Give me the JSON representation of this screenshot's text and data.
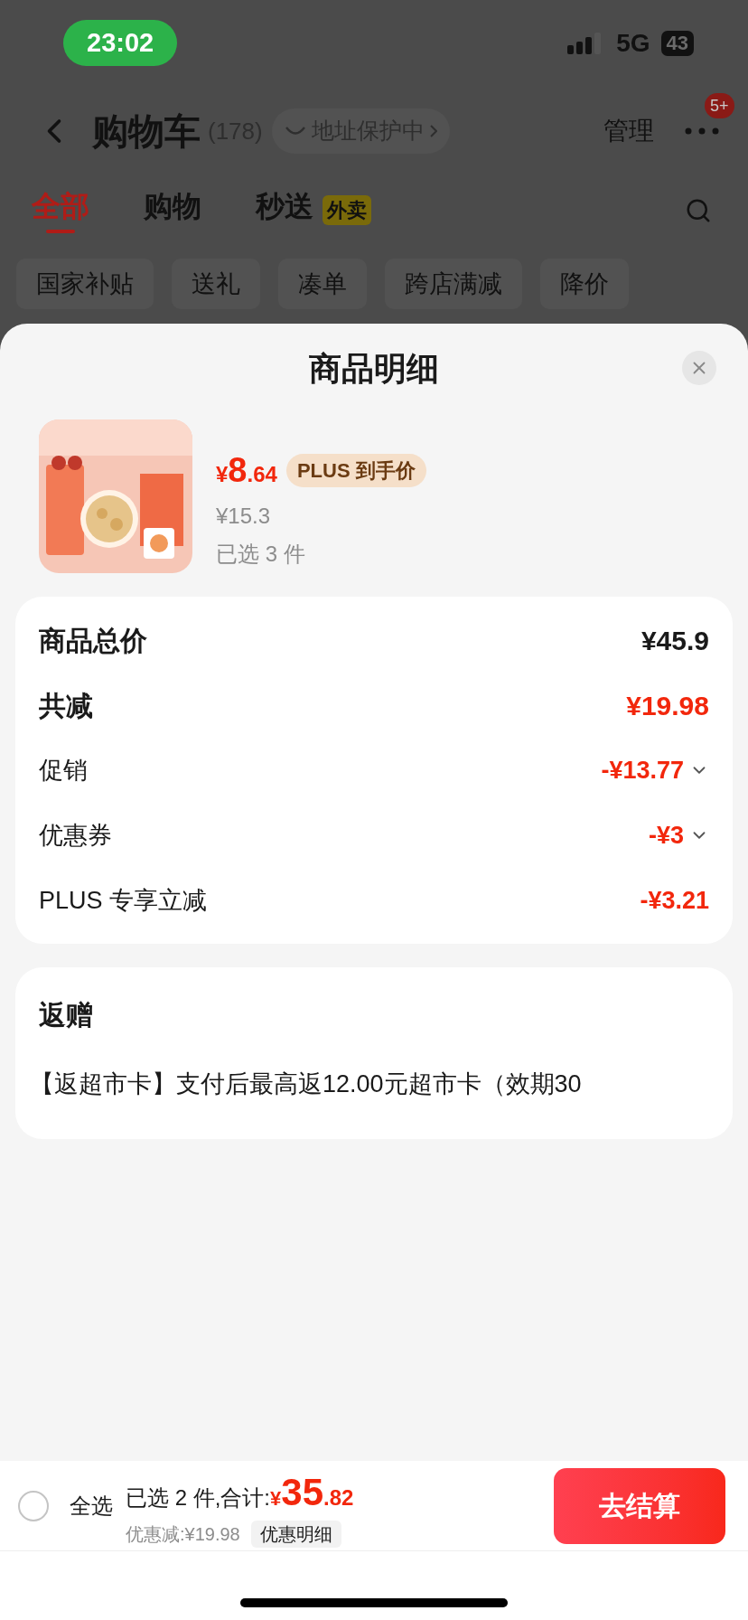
{
  "status_bar": {
    "time": "23:02",
    "network": "5G",
    "battery": "43"
  },
  "header": {
    "title": "购物车",
    "count": "(178)",
    "address_badge": "地址保护中",
    "manage": "管理",
    "more_badge": "5+"
  },
  "tabs": [
    {
      "label": "全部",
      "selected": true
    },
    {
      "label": "购物",
      "selected": false
    },
    {
      "label": "秒送",
      "selected": false,
      "tag": "外卖"
    }
  ],
  "chips": [
    "国家补贴",
    "送礼",
    "凑单",
    "跨店满减",
    "降价"
  ],
  "sheet": {
    "title": "商品明细",
    "product": {
      "currency": "¥",
      "price_int": "8",
      "price_dec": ".64",
      "badge": "PLUS 到手价",
      "original_price": "¥15.3",
      "quantity": "已选 3 件"
    },
    "summary": [
      {
        "kind": "total",
        "label": "商品总价",
        "value": "¥45.9",
        "expandable": false
      },
      {
        "kind": "discount_total",
        "label": "共减",
        "value": "¥19.98",
        "expandable": false
      },
      {
        "kind": "item",
        "label": "促销",
        "value": "-¥13.77",
        "expandable": true
      },
      {
        "kind": "item",
        "label": "优惠券",
        "value": "-¥3",
        "expandable": true
      },
      {
        "kind": "item",
        "label": "PLUS 专享立减",
        "value": "-¥3.21",
        "expandable": false
      }
    ],
    "returns": {
      "title": "返赠",
      "text": "【返超市卡】支付后最高返12.00元超市卡（效期30"
    }
  },
  "footer": {
    "select_all": {
      "label": "全选",
      "checked": false
    },
    "summary": "已选 2 件,合计:",
    "currency": "¥",
    "total_int": "35",
    "total_dec": ".82",
    "saving": "优惠减:¥19.98",
    "detail_button": "优惠明细",
    "checkout": "去结算"
  }
}
